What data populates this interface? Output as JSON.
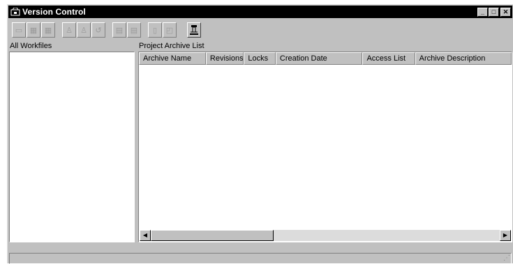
{
  "window": {
    "title": "Version Control",
    "icon": "app-icon",
    "controls": {
      "minimize": "_",
      "maximize": "□",
      "close": "✕"
    }
  },
  "toolbar": {
    "buttons": [
      {
        "icon": "new-archive-icon",
        "glyph": "▭",
        "enabled": false
      },
      {
        "icon": "add-file-icon",
        "glyph": "▦",
        "enabled": false
      },
      {
        "icon": "remove-file-icon",
        "glyph": "▦",
        "enabled": false
      },
      {
        "icon": "checkin-icon",
        "glyph": "♙",
        "enabled": false
      },
      {
        "icon": "checkout-icon",
        "glyph": "♙",
        "enabled": false
      },
      {
        "icon": "undo-checkout-icon",
        "glyph": "↺",
        "enabled": false
      },
      {
        "icon": "get-file-icon",
        "glyph": "▤",
        "enabled": false
      },
      {
        "icon": "view-file-icon",
        "glyph": "▤",
        "enabled": false
      },
      {
        "icon": "properties-icon",
        "glyph": "▯",
        "enabled": false
      },
      {
        "icon": "history-icon",
        "glyph": "◰",
        "enabled": false
      },
      {
        "icon": "archive-tool-icon",
        "glyph": "⊓",
        "enabled": true
      }
    ]
  },
  "left_pane": {
    "label": "All Workfiles"
  },
  "right_pane": {
    "label": "Project Archive List",
    "columns": [
      "Archive Name",
      "Revisions",
      "Locks",
      "Creation Date",
      "Access List",
      "Archive Description"
    ]
  },
  "scrollbar": {
    "left_arrow": "◀",
    "right_arrow": "▶"
  }
}
